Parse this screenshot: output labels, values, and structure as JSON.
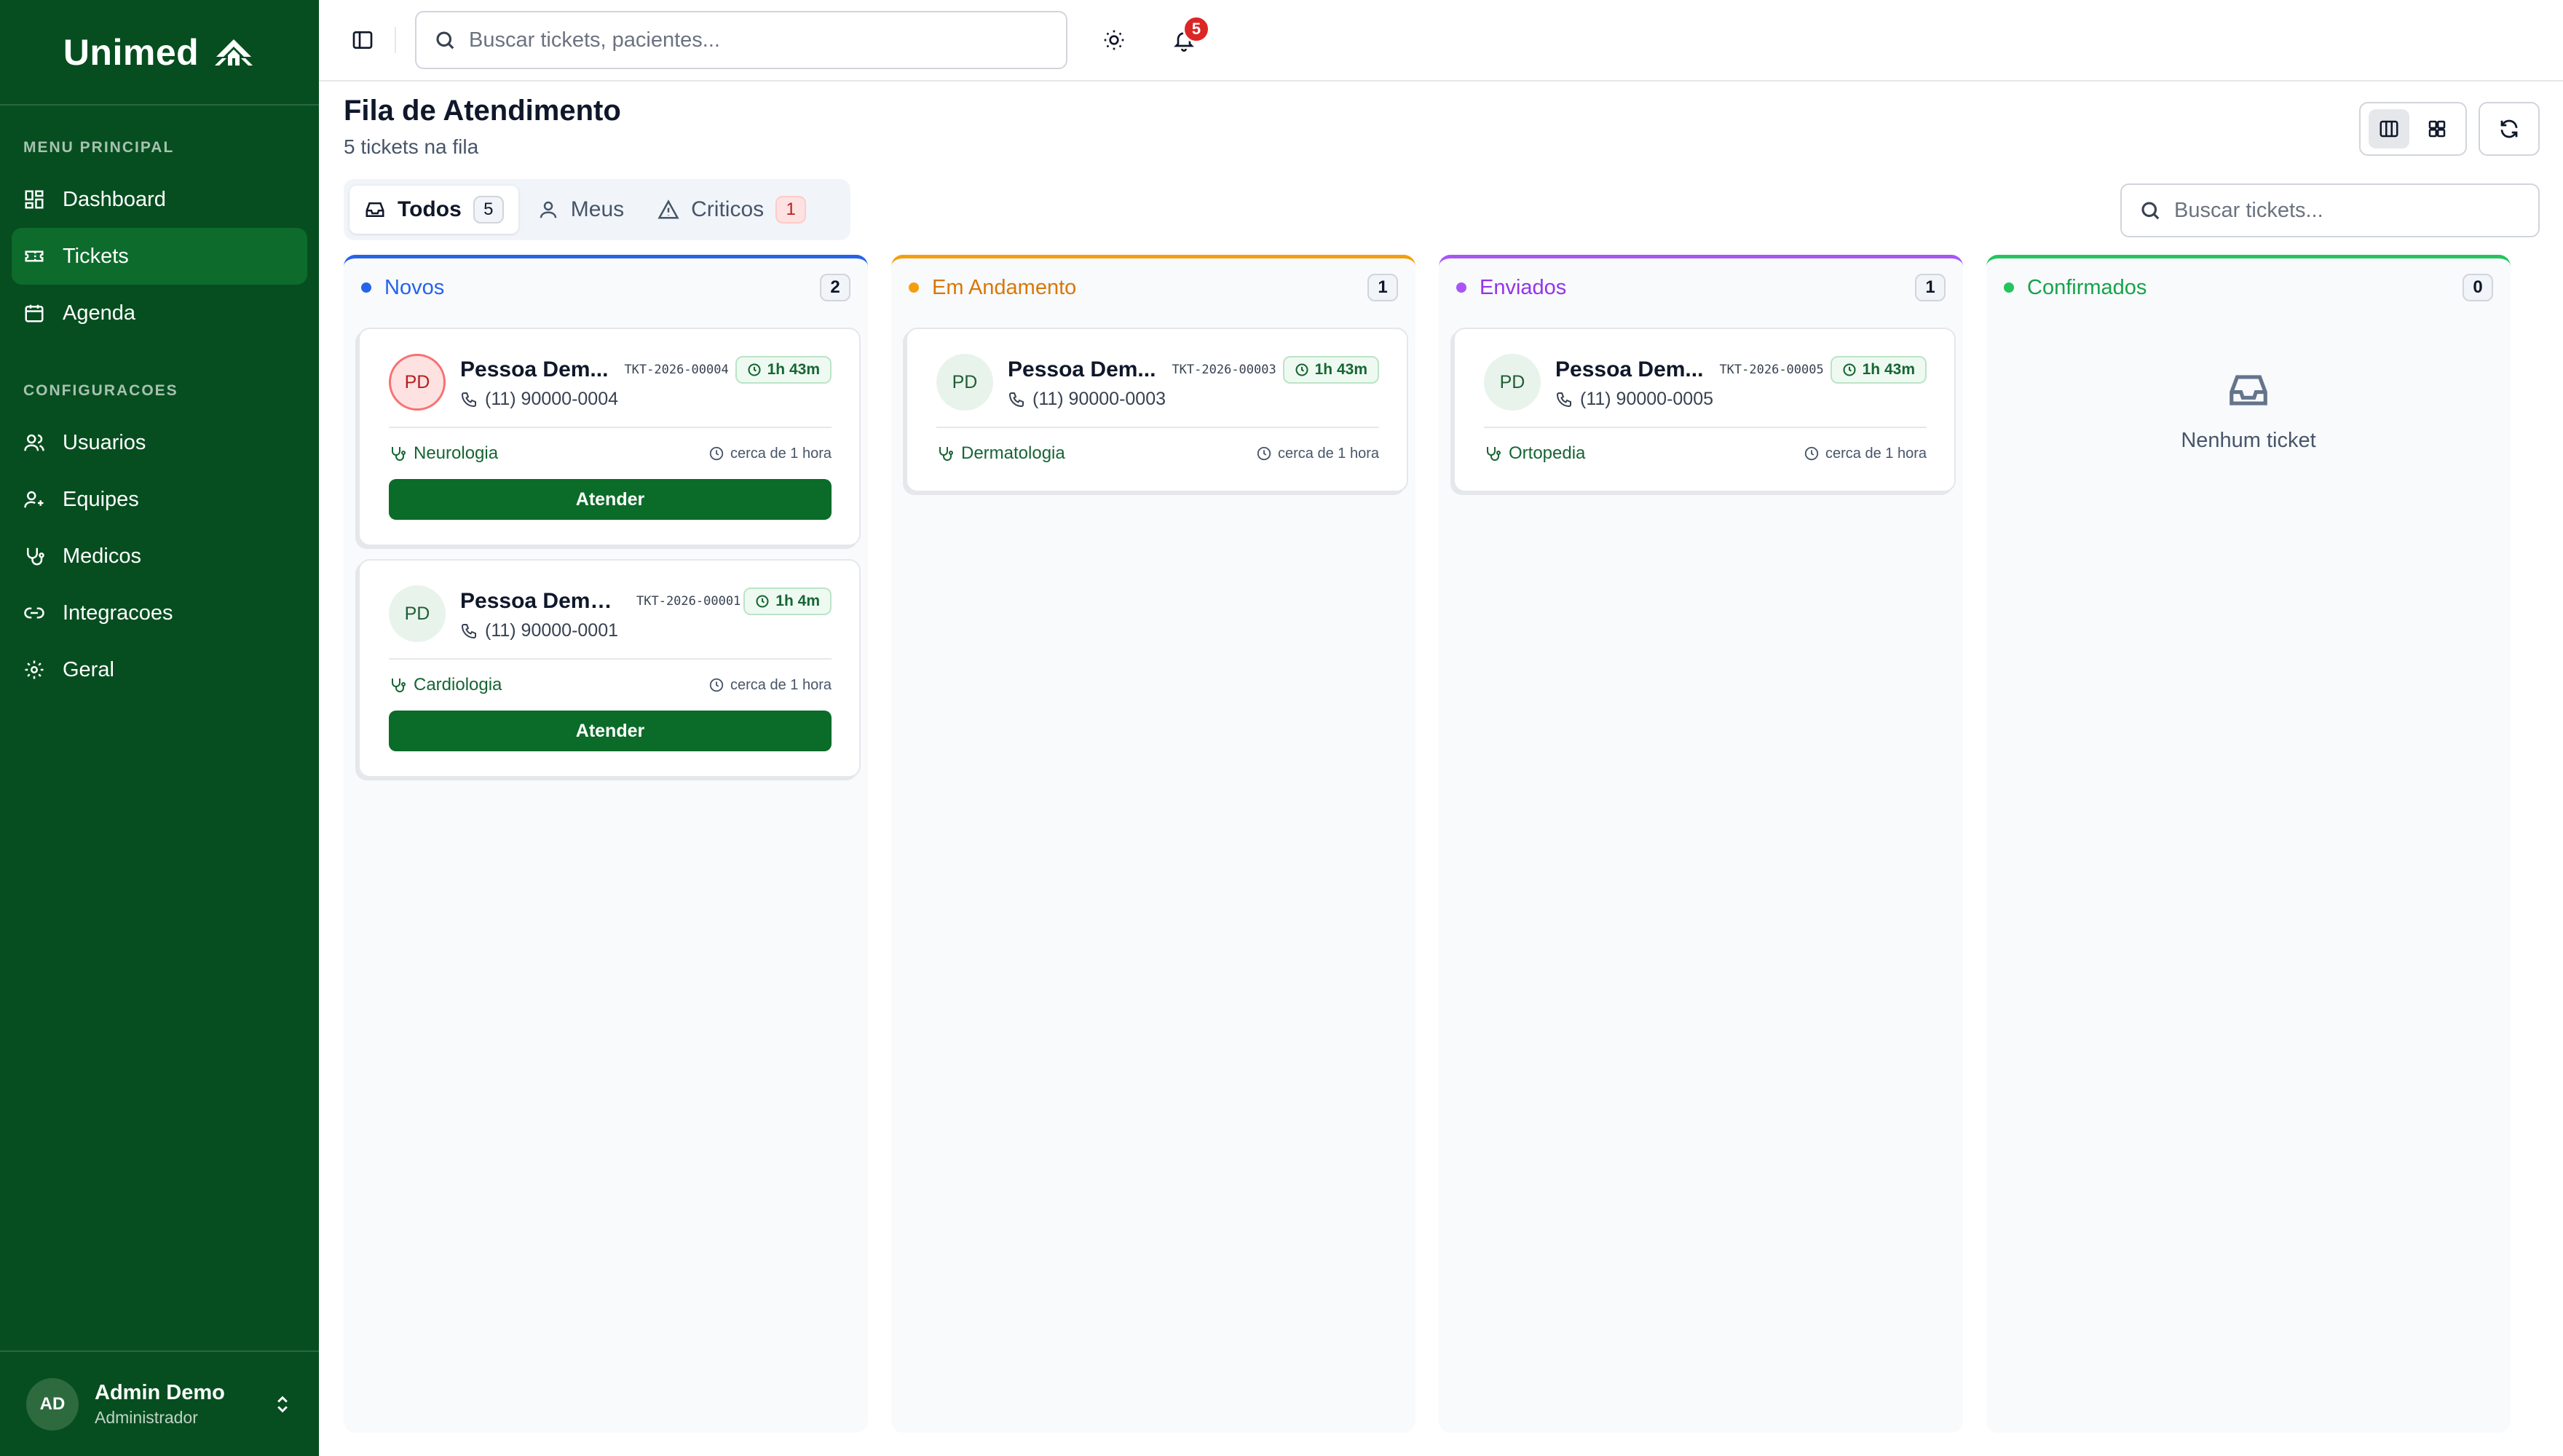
{
  "brand": {
    "name": "Unimed"
  },
  "sidebar": {
    "main_section": "MENU PRINCIPAL",
    "main_items": [
      {
        "label": "Dashboard",
        "icon": "dashboard-icon"
      },
      {
        "label": "Tickets",
        "icon": "ticket-icon",
        "active": true
      },
      {
        "label": "Agenda",
        "icon": "calendar-icon"
      }
    ],
    "config_section": "CONFIGURACOES",
    "config_items": [
      {
        "label": "Usuarios",
        "icon": "users-icon"
      },
      {
        "label": "Equipes",
        "icon": "team-icon"
      },
      {
        "label": "Medicos",
        "icon": "stethoscope-icon"
      },
      {
        "label": "Integracoes",
        "icon": "link-icon"
      },
      {
        "label": "Geral",
        "icon": "gear-icon"
      }
    ],
    "user": {
      "initials": "AD",
      "name": "Admin Demo",
      "role": "Administrador"
    }
  },
  "topbar": {
    "search_placeholder": "Buscar tickets, pacientes...",
    "notification_count": "5"
  },
  "header": {
    "title": "Fila de Atendimento",
    "subtitle": "5 tickets na fila"
  },
  "filters": {
    "tabs": [
      {
        "label": "Todos",
        "count": "5",
        "active": true
      },
      {
        "label": "Meus"
      },
      {
        "label": "Criticos",
        "count": "1"
      }
    ],
    "search_placeholder": "Buscar tickets..."
  },
  "columns": [
    {
      "title": "Novos",
      "count": "2",
      "color": "#2563eb",
      "cards": [
        {
          "initials": "PD",
          "name": "Pessoa Dem...",
          "ticket": "TKT-2026-00004",
          "time": "1h 43m",
          "phone": "(11) 90000-0004",
          "specialty": "Neurologia",
          "ago": "cerca de 1 hora",
          "action": "Atender",
          "critical": true
        },
        {
          "initials": "PD",
          "name": "Pessoa Demo...",
          "ticket": "TKT-2026-00001",
          "time": "1h 4m",
          "phone": "(11) 90000-0001",
          "specialty": "Cardiologia",
          "ago": "cerca de 1 hora",
          "action": "Atender"
        }
      ]
    },
    {
      "title": "Em Andamento",
      "count": "1",
      "color": "#d97706",
      "cards": [
        {
          "initials": "PD",
          "name": "Pessoa Dem...",
          "ticket": "TKT-2026-00003",
          "time": "1h 43m",
          "phone": "(11) 90000-0003",
          "specialty": "Dermatologia",
          "ago": "cerca de 1 hora"
        }
      ]
    },
    {
      "title": "Enviados",
      "count": "1",
      "color": "#9333ea",
      "cards": [
        {
          "initials": "PD",
          "name": "Pessoa Dem...",
          "ticket": "TKT-2026-00005",
          "time": "1h 43m",
          "phone": "(11) 90000-0005",
          "specialty": "Ortopedia",
          "ago": "cerca de 1 hora"
        }
      ]
    },
    {
      "title": "Confirmados",
      "count": "0",
      "color": "#16a34a",
      "empty_text": "Nenhum ticket"
    }
  ]
}
